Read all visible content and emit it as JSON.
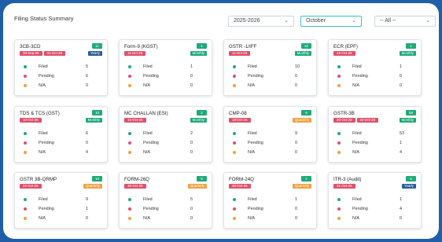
{
  "page": {
    "title": "Filing Status Summary",
    "year_select": "2025-2026",
    "month_select": "October",
    "filter_select": "-- All --",
    "row_labels": [
      "Filed",
      "Pending",
      "N/A"
    ]
  },
  "colors": {
    "frame_bg": "#1f5fa8",
    "filed": "#1eaa78",
    "pending": "#e0506a",
    "na": "#f0a040",
    "monthly": "#1eaa78",
    "quarterly": "#f0a040",
    "yearly": "#2a5d9a",
    "date_badge": "#e0506a",
    "count_badge": "#1eaa78"
  },
  "cards": [
    {
      "title": "3CB-3CD",
      "count": "11",
      "dates": [
        "30-Sep-25",
        "31-Oct-25"
      ],
      "frequency": "Yearly",
      "freq_color": "#2a5d9a",
      "filed": "5",
      "pending": "6",
      "na": "0"
    },
    {
      "title": "Form-9 (KGST)",
      "count": "1",
      "dates": [
        "11-Oct-25"
      ],
      "frequency": "Monthly",
      "freq_color": "#1eaa78",
      "filed": "1",
      "pending": "0",
      "na": "0"
    },
    {
      "title": "GSTR -1/IFF",
      "count": "10",
      "dates": [
        "11-Oct-25"
      ],
      "frequency": "Monthly",
      "freq_color": "#1eaa78",
      "filed": "10",
      "pending": "0",
      "na": "0"
    },
    {
      "title": "ECR (EPF)",
      "count": "1",
      "dates": [
        "15-Oct-25"
      ],
      "frequency": "Monthly",
      "freq_color": "#1eaa78",
      "filed": "1",
      "pending": "0",
      "na": "0"
    },
    {
      "title": "TDS & TCS (GST)",
      "count": "10",
      "dates": [
        "10-Oct-25"
      ],
      "frequency": "Monthly",
      "freq_color": "#1eaa78",
      "filed": "6",
      "pending": "0",
      "na": "4"
    },
    {
      "title": "MC CHALLAN (ESI)",
      "count": "2",
      "dates": [
        "15-Oct-25"
      ],
      "frequency": "Monthly",
      "freq_color": "#1eaa78",
      "filed": "2",
      "pending": "0",
      "na": "0"
    },
    {
      "title": "CMP-08",
      "count": "9",
      "dates": [
        "18-Oct-25"
      ],
      "frequency": "Quarterly",
      "freq_color": "#f0a040",
      "filed": "9",
      "pending": "0",
      "na": "0"
    },
    {
      "title": "GSTR-3B",
      "count": "58",
      "dates": [
        "20-Oct-25",
        "22-Oct-25"
      ],
      "frequency": "Monthly",
      "freq_color": "#1eaa78",
      "filed": "53",
      "pending": "1",
      "na": "4"
    },
    {
      "title": "GSTR 3B-QRMP",
      "count": "10",
      "dates": [
        "22-Oct-25"
      ],
      "frequency": "Quarterly",
      "freq_color": "#f0a040",
      "filed": "9",
      "pending": "1",
      "na": "0"
    },
    {
      "title": "FORM-26Q",
      "count": "5",
      "dates": [
        "30-Oct-25"
      ],
      "frequency": "Quarterly",
      "freq_color": "#f0a040",
      "filed": "5",
      "pending": "0",
      "na": "0"
    },
    {
      "title": "FORM-24Q",
      "count": "2",
      "dates": [
        "30-Oct-25"
      ],
      "frequency": "Quarterly",
      "freq_color": "#f0a040",
      "filed": "1",
      "pending": "0",
      "na": "0"
    },
    {
      "title": "ITR-3 (Audit)",
      "count": "5",
      "dates": [
        "31-Oct-25"
      ],
      "frequency": "Yearly",
      "freq_color": "#2a5d9a",
      "filed": "1",
      "pending": "4",
      "na": "0"
    }
  ]
}
